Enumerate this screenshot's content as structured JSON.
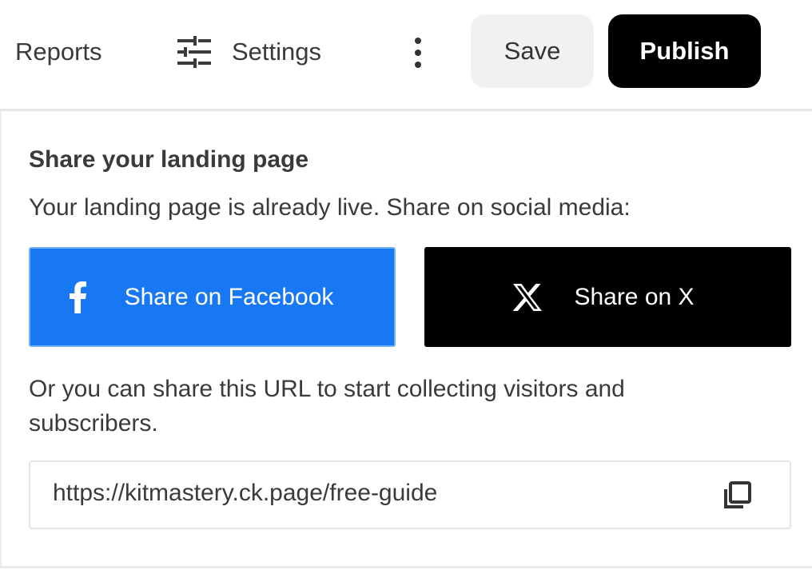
{
  "topbar": {
    "reports_label": "Reports",
    "settings_label": "Settings",
    "save_label": "Save",
    "publish_label": "Publish",
    "icons": {
      "settings": "sliders-icon",
      "more": "kebab-menu-icon"
    }
  },
  "share_panel": {
    "title": "Share your landing page",
    "description": "Your landing page is already live. Share on social media:",
    "facebook_button": {
      "label": "Share on Facebook",
      "icon": "facebook-icon",
      "color": "#1877f2"
    },
    "x_button": {
      "label": "Share on X",
      "icon": "x-logo-icon",
      "color": "#000000"
    },
    "url_help": "Or you can share this URL to start collecting visitors and subscribers.",
    "url_value": "https://kitmastery.ck.page/free-guide",
    "copy_icon": "copy-icon"
  },
  "colors": {
    "publish_bg": "#000000",
    "save_bg": "#f1f1f1",
    "facebook_blue": "#1877f2",
    "text": "#3a3a3a"
  }
}
